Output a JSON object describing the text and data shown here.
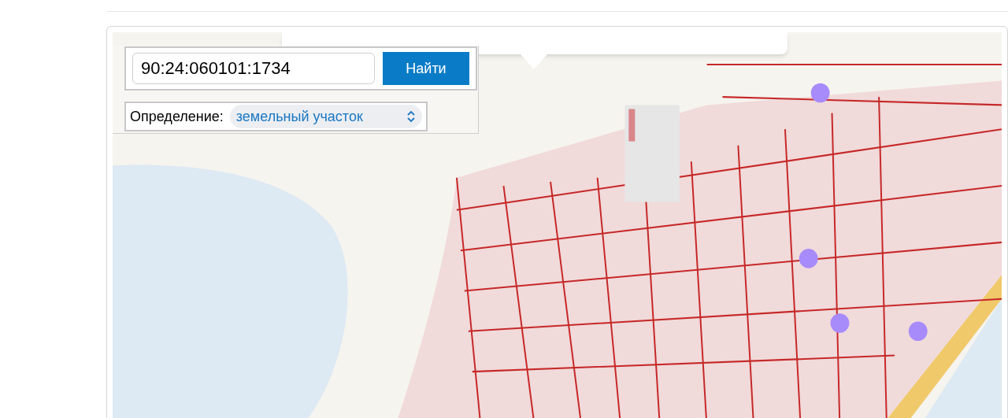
{
  "search": {
    "value": "90:24:060101:1734",
    "button": "Найти"
  },
  "definition": {
    "label": "Определение:",
    "value": "земельный участок"
  }
}
